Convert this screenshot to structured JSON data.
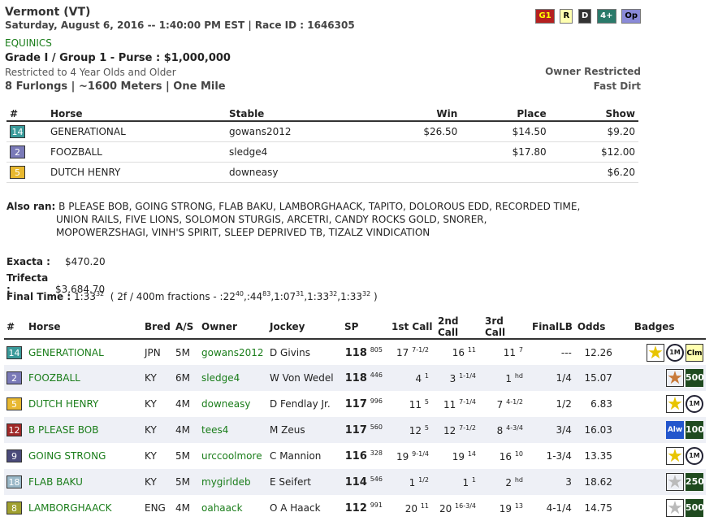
{
  "race": {
    "location": "Vermont (VT)",
    "datetime": "Saturday, August 6, 2016 -- 1:40:00 PM EST | Race ID : 1646305",
    "track": "EQUINICS",
    "grade_purse": "Grade I / Group 1 - Purse : $1,000,000",
    "restriction": "Restricted to 4 Year Olds and Older",
    "distance": "8 Furlongs | ~1600 Meters | One Mile",
    "owner_restricted": "Owner Restricted",
    "surface": "Fast Dirt",
    "tags": [
      "G1",
      "R",
      "D",
      "4+",
      "Op"
    ]
  },
  "payout_table": {
    "headers": [
      "#",
      "Horse",
      "Stable",
      "Win",
      "Place",
      "Show"
    ],
    "rows": [
      {
        "num": "14",
        "horse": "GENERATIONAL",
        "stable": "gowans2012",
        "win": "$26.50",
        "place": "$14.50",
        "show": "$9.20"
      },
      {
        "num": "2",
        "horse": "FOOZBALL",
        "stable": "sledge4",
        "win": "",
        "place": "$17.80",
        "show": "$12.00"
      },
      {
        "num": "5",
        "horse": "DUTCH HENRY",
        "stable": "downeasy",
        "win": "",
        "place": "",
        "show": "$6.20"
      }
    ]
  },
  "also_ran": {
    "label": "Also ran:",
    "line1": "B PLEASE BOB, GOING STRONG, FLAB BAKU, LAMBORGHAACK, TAPITO, DOLOROUS EDD, RECORDED TIME,",
    "line2": "UNION RAILS, FIVE LIONS, SOLOMON STURGIS, ARCETRI, CANDY ROCKS GOLD, SNORER,",
    "line3": "MOPOWERZSHAGI, VINH'S SPIRIT, SLEEP DEPRIVED TB, TIZALZ VINDICATION"
  },
  "exotics": {
    "exacta_label": "Exacta :",
    "exacta_value": "$470.20",
    "trifecta_label": "Trifecta :",
    "trifecta_value": "$3,684.70"
  },
  "final_time": {
    "label": "Final Time :",
    "time": "1:33",
    "time_sup": "32",
    "fractions_prefix": "( 2f / 400m fractions - :22",
    "f1_sup": "40",
    "f2": ",:44",
    "f2_sup": "83",
    "f3": ",1:07",
    "f3_sup": "31",
    "f4": ",1:33",
    "f4_sup": "32",
    "f5": ",1:33",
    "f5_sup": "32",
    "suffix": ")"
  },
  "results_table": {
    "headers": [
      "#",
      "Horse",
      "Bred",
      "A/S",
      "Owner",
      "Jockey",
      "SP",
      "1st Call",
      "2nd Call",
      "3rd Call",
      "FinalLB",
      "Odds",
      "Badges"
    ],
    "rows": [
      {
        "num": "14",
        "color": "#3a9a9a",
        "horse": "GENERATIONAL",
        "bred": "JPN",
        "as": "5M",
        "owner": "gowans2012",
        "jockey": "D Givins",
        "sp": "118",
        "sp_sup": "805",
        "c1": "17",
        "c1s": "7-1/2",
        "c2": "16",
        "c2s": "11",
        "c3": "11",
        "c3s": "7",
        "final": "---",
        "odds": "12.26",
        "badges": [
          "G1 star",
          "1M",
          "Clm"
        ]
      },
      {
        "num": "2",
        "color": "#7a7ab8",
        "horse": "FOOZBALL",
        "bred": "KY",
        "as": "6M",
        "owner": "sledge4",
        "jockey": "W Von Wedel",
        "sp": "118",
        "sp_sup": "446",
        "c1": "4",
        "c1s": "1",
        "c2": "3",
        "c2s": "1-1/4",
        "c3": "1",
        "c3s": "hd",
        "final": "1/4",
        "odds": "15.07",
        "badges": [
          "G3 star",
          "500"
        ]
      },
      {
        "num": "5",
        "color": "#e8b830",
        "horse": "DUTCH HENRY",
        "bred": "KY",
        "as": "4M",
        "owner": "downeasy",
        "jockey": "D Fendlay Jr.",
        "sp": "117",
        "sp_sup": "996",
        "c1": "11",
        "c1s": "5",
        "c2": "11",
        "c2s": "7-1/4",
        "c3": "7",
        "c3s": "4-1/2",
        "final": "1/2",
        "odds": "6.83",
        "badges": [
          "star",
          "1M"
        ]
      },
      {
        "num": "12",
        "color": "#a02828",
        "horse": "B PLEASE BOB",
        "bred": "KY",
        "as": "4M",
        "owner": "tees4",
        "jockey": "M Zeus",
        "sp": "117",
        "sp_sup": "560",
        "c1": "12",
        "c1s": "5",
        "c2": "12",
        "c2s": "7-1/2",
        "c3": "8",
        "c3s": "4-3/4",
        "final": "3/4",
        "odds": "16.03",
        "badges": [
          "Alw",
          "100"
        ]
      },
      {
        "num": "9",
        "color": "#4a4a7a",
        "horse": "GOING STRONG",
        "bred": "KY",
        "as": "5M",
        "owner": "urccoolmore",
        "jockey": "C Mannion",
        "sp": "116",
        "sp_sup": "328",
        "c1": "19",
        "c1s": "9-1/4",
        "c2": "19",
        "c2s": "14",
        "c3": "16",
        "c3s": "10",
        "final": "1-3/4",
        "odds": "13.35",
        "badges": [
          "G1 star",
          "1M"
        ]
      },
      {
        "num": "18",
        "color": "#9ab8c8",
        "horse": "FLAB BAKU",
        "bred": "KY",
        "as": "5M",
        "owner": "mygirldeb",
        "jockey": "E Seifert",
        "sp": "114",
        "sp_sup": "546",
        "c1": "1",
        "c1s": "1/2",
        "c2": "1",
        "c2s": "1",
        "c3": "2",
        "c3s": "hd",
        "final": "3",
        "odds": "18.62",
        "badges": [
          "G2 star",
          "250"
        ]
      },
      {
        "num": "8",
        "color": "#a0a030",
        "horse": "LAMBORGHAACK",
        "bred": "ENG",
        "as": "4M",
        "owner": "oahaack",
        "jockey": "O A Haack",
        "sp": "112",
        "sp_sup": "991",
        "c1": "20",
        "c1s": "11",
        "c2": "20",
        "c2s": "16-3/4",
        "c3": "19",
        "c3s": "13",
        "final": "4-1/4",
        "odds": "14.75",
        "badges": [
          "G2 star",
          "500"
        ]
      }
    ]
  }
}
